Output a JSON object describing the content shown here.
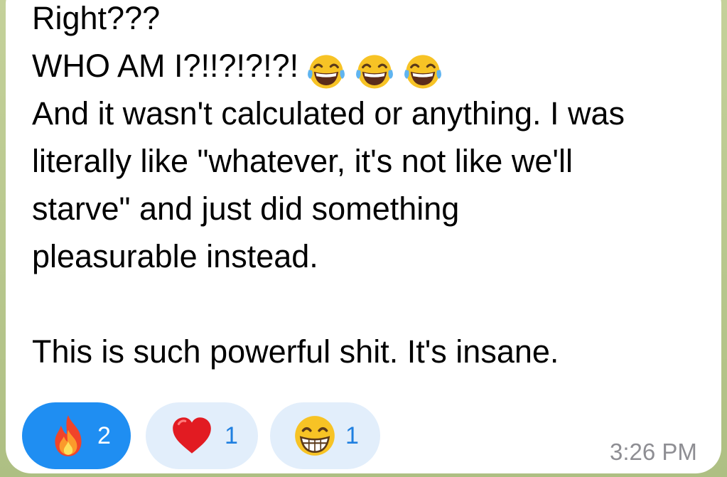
{
  "message": {
    "lines": [
      "Right???",
      "WHO AM I?!!?!?!?!",
      "And it wasn't calculated or anything. I was",
      "literally like \"whatever, it's not like we'll",
      "starve\" and just did something",
      "pleasurable instead.",
      "",
      "This is such powerful shit. It's insane."
    ],
    "inline_emojis": [
      "face-with-tears-of-joy-icon",
      "face-with-tears-of-joy-icon",
      "face-with-tears-of-joy-icon"
    ],
    "timestamp": "3:26 PM"
  },
  "reactions": [
    {
      "icon": "fire-icon",
      "count": "2",
      "selected": true
    },
    {
      "icon": "red-heart-icon",
      "count": "1",
      "selected": false
    },
    {
      "icon": "beaming-face-icon",
      "count": "1",
      "selected": false
    }
  ],
  "colors": {
    "bubble": "#ffffff",
    "text": "#000000",
    "reaction_active": "#1f8ef2",
    "reaction_inactive": "#e2eefb",
    "reaction_count_inactive": "#1f7fe0",
    "timestamp": "#8e8e93",
    "chat_background": "#b9c98f"
  }
}
